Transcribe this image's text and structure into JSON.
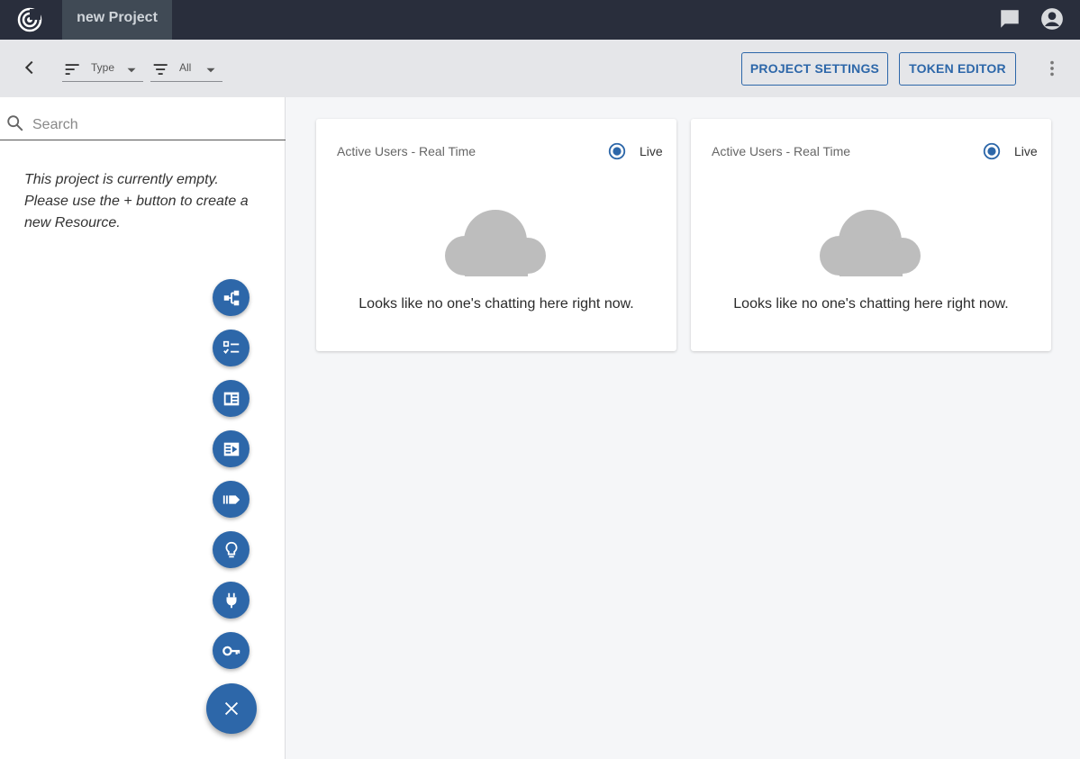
{
  "topbar": {
    "project_name": "new Project"
  },
  "toolbar": {
    "filter_type_label": "Type",
    "filter_all_label": "All",
    "project_settings_label": "PROJECT SETTINGS",
    "token_editor_label": "TOKEN EDITOR"
  },
  "sidebar": {
    "search_placeholder": "Search",
    "empty_message": "This project is currently empty. Please use the + button to create a new Resource.",
    "fab_icons": [
      "flow-icon",
      "checklist-icon",
      "article-icon",
      "video-icon",
      "label-icon",
      "lightbulb-icon",
      "plug-icon",
      "key-icon"
    ],
    "close_icon": "close-icon"
  },
  "cards": [
    {
      "title": "Active Users - Real Time",
      "live_label": "Live",
      "message": "Looks like no one's chatting here right now."
    },
    {
      "title": "Active Users - Real Time",
      "live_label": "Live",
      "message": "Looks like no one's chatting here right now."
    }
  ],
  "colors": {
    "accent": "#2d67a9",
    "topbar": "#292e3c",
    "toolbar": "#e5e6e9",
    "cloud": "#bdbdbd"
  }
}
